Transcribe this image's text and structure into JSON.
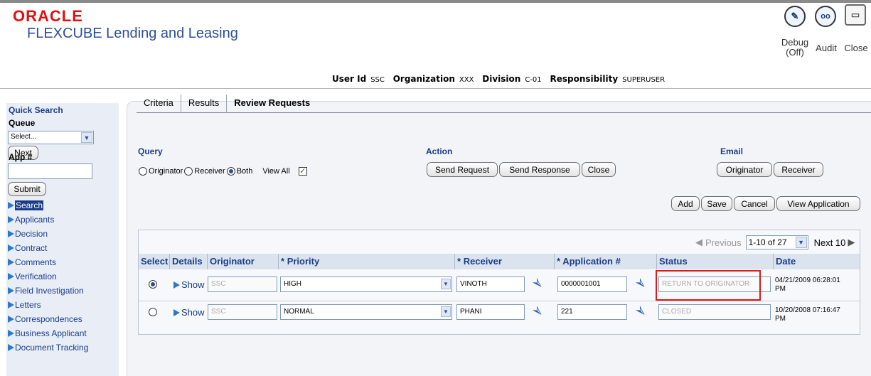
{
  "header": {
    "logo": "ORACLE",
    "product": "FLEXCUBE Lending and Leasing",
    "userbar": [
      {
        "label": "User Id",
        "value": "SSC"
      },
      {
        "label": "Organization",
        "value": "XXX"
      },
      {
        "label": "Division",
        "value": "C-01"
      },
      {
        "label": "Responsibility",
        "value": "SUPERUSER"
      }
    ],
    "debug_label": "Debug",
    "debug_state": "(Off)",
    "audit_label": "Audit",
    "close_label": "Close"
  },
  "leftnav": {
    "title": "Quick Search",
    "queue_label": "Queue",
    "queue_value": "Select...",
    "next_label": "Next",
    "app_label": "App #",
    "app_value": "",
    "submit_label": "Submit",
    "items": [
      {
        "label": "Search",
        "active": true
      },
      {
        "label": "Applicants"
      },
      {
        "label": "Decision"
      },
      {
        "label": "Contract"
      },
      {
        "label": "Comments"
      },
      {
        "label": "Verification"
      },
      {
        "label": "Field Investigation"
      },
      {
        "label": "Letters"
      },
      {
        "label": "Correspondences"
      },
      {
        "label": "Business Applicant"
      },
      {
        "label": "Document Tracking"
      }
    ]
  },
  "tabs": [
    {
      "label": "Criteria"
    },
    {
      "label": "Results"
    },
    {
      "label": "Review Requests",
      "active": true
    }
  ],
  "query": {
    "label": "Query",
    "originator": "Originator",
    "receiver": "Receiver",
    "both": "Both",
    "selected": "Both",
    "view_all": "View All",
    "view_all_checked": true
  },
  "action": {
    "label": "Action",
    "send_request": "Send Request",
    "send_response": "Send Response",
    "close": "Close"
  },
  "email": {
    "label": "Email",
    "originator": "Originator",
    "receiver": "Receiver"
  },
  "toolbar": {
    "add": "Add",
    "save": "Save",
    "cancel": "Cancel",
    "view_application": "View Application"
  },
  "pager": {
    "previous": "Previous",
    "range": "1-10 of 27",
    "next": "Next 10"
  },
  "table": {
    "columns": [
      "Select",
      "Details",
      "Originator",
      "Priority",
      "Receiver",
      "Application #",
      "Status",
      "Date"
    ],
    "required_mark": "*",
    "rows": [
      {
        "selected": true,
        "details": "Show",
        "originator": "SSC",
        "priority": "HIGH",
        "receiver": "VINOTH",
        "application": "0000001001",
        "status": "RETURN TO ORIGINATOR",
        "date1": "04/21/2009 06:28:01",
        "date2": "PM"
      },
      {
        "selected": false,
        "details": "Show",
        "originator": "SSC",
        "priority": "NORMAL",
        "receiver": "PHANI",
        "application": "221",
        "status": "CLOSED",
        "date1": "10/20/2008 07:16:47",
        "date2": "PM"
      }
    ]
  },
  "colors": {
    "brand_red": "#e01010",
    "link_blue": "#1a3d8a",
    "highlight": "#e01818"
  }
}
